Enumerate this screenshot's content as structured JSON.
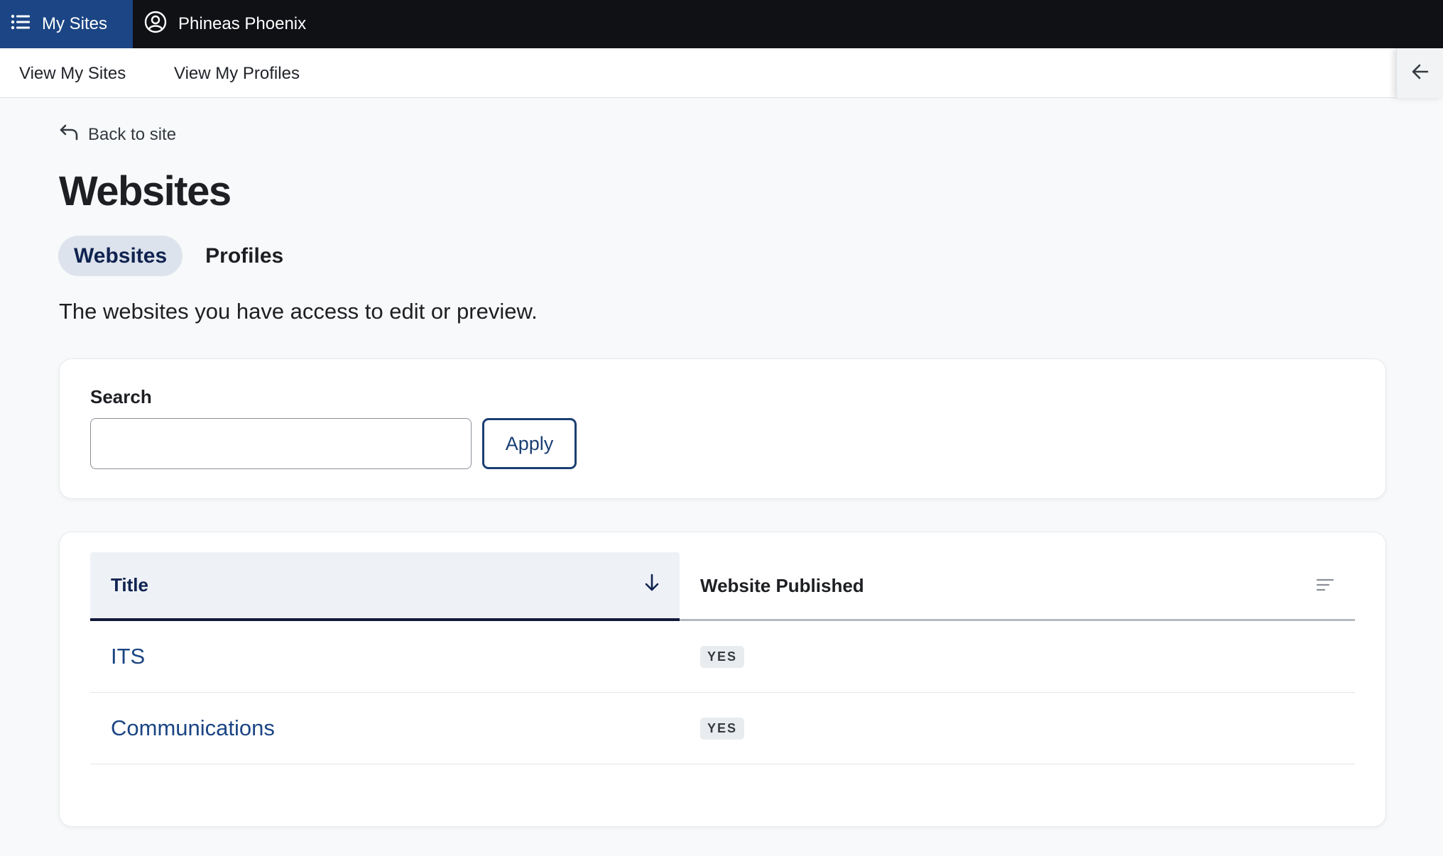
{
  "topbar": {
    "my_sites_label": "My Sites",
    "user_name": "Phineas Phoenix"
  },
  "subnav": {
    "link1": "View My Sites",
    "link2": "View My Profiles"
  },
  "main": {
    "back_label": "Back to site",
    "title": "Websites",
    "tabs": [
      {
        "label": "Websites",
        "active": true
      },
      {
        "label": "Profiles",
        "active": false
      }
    ],
    "description": "The websites you have access to edit or preview."
  },
  "search": {
    "label": "Search",
    "value": "",
    "apply_label": "Apply"
  },
  "table": {
    "columns": [
      "Title",
      "Website Published"
    ],
    "rows": [
      {
        "title": "ITS",
        "published": "YES"
      },
      {
        "title": "Communications",
        "published": "YES"
      }
    ]
  },
  "colors": {
    "accent": "#1b4584",
    "topbar": "#0f1114"
  }
}
